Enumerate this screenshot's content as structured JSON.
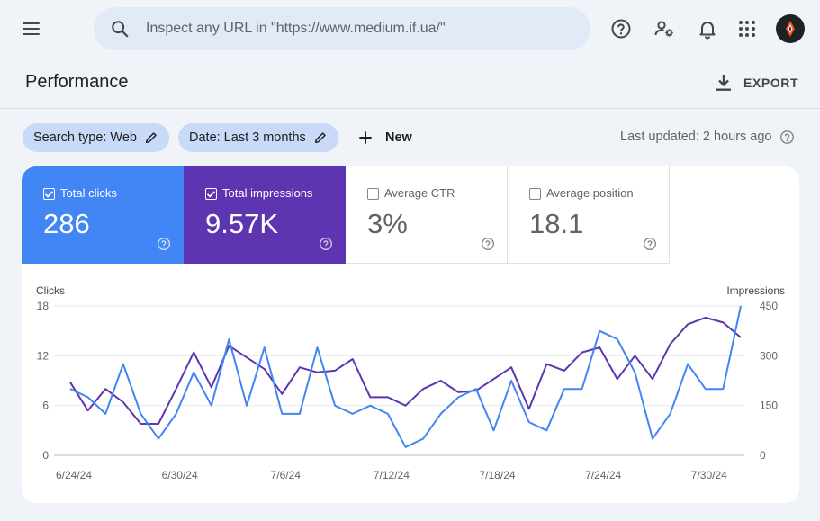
{
  "header": {
    "search_placeholder": "Inspect any URL in \"https://www.medium.if.ua/\"",
    "icons": [
      "menu-icon",
      "search-icon",
      "help-icon",
      "manage-users-icon",
      "notifications-icon",
      "apps-icon",
      "avatar"
    ]
  },
  "page": {
    "title": "Performance",
    "export_label": "EXPORT"
  },
  "filters": {
    "search_type": "Search type: Web",
    "date": "Date: Last 3 months",
    "new_label": "New",
    "last_updated": "Last updated: 2 hours ago"
  },
  "metrics": [
    {
      "label": "Total clicks",
      "value": "286",
      "checked": true,
      "color": "#4285f4"
    },
    {
      "label": "Total impressions",
      "value": "9.57K",
      "checked": true,
      "color": "#5e35b1"
    },
    {
      "label": "Average CTR",
      "value": "3%",
      "checked": false
    },
    {
      "label": "Average position",
      "value": "18.1",
      "checked": false
    }
  ],
  "chart_data": {
    "type": "line",
    "left_axis": {
      "label": "Clicks",
      "ticks": [
        0,
        6,
        12,
        18
      ],
      "range": [
        0,
        18
      ]
    },
    "right_axis": {
      "label": "Impressions",
      "ticks": [
        0,
        150,
        300,
        450
      ],
      "range": [
        0,
        450
      ]
    },
    "x_tick_labels": [
      "6/24/24",
      "6/30/24",
      "7/6/24",
      "7/12/24",
      "7/18/24",
      "7/24/24",
      "7/30/24"
    ],
    "x_tick_index": [
      0,
      6,
      12,
      18,
      24,
      30,
      36
    ],
    "series": [
      {
        "name": "Clicks",
        "axis": "left",
        "color": "#4285f4",
        "values": [
          8,
          7,
          5,
          11,
          5,
          2,
          5,
          10,
          6,
          14,
          6,
          13,
          5,
          5,
          13,
          6,
          5,
          6,
          5,
          1,
          2,
          5,
          7,
          8,
          3,
          9,
          4,
          3,
          8,
          8,
          15,
          14,
          10,
          2,
          5,
          11,
          8,
          8,
          18
        ]
      },
      {
        "name": "Impressions",
        "axis": "right",
        "color": "#5e35b1",
        "values": [
          220,
          135,
          200,
          160,
          95,
          95,
          200,
          310,
          205,
          330,
          295,
          260,
          185,
          265,
          250,
          255,
          290,
          175,
          175,
          150,
          200,
          225,
          190,
          195,
          230,
          265,
          140,
          275,
          255,
          310,
          325,
          230,
          300,
          230,
          335,
          395,
          415,
          400,
          355
        ]
      }
    ]
  }
}
